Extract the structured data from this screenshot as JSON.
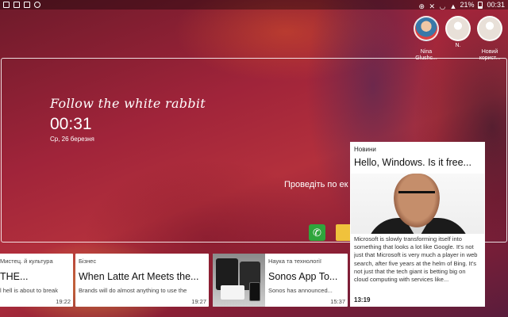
{
  "status_bar": {
    "time": "00:31",
    "battery": "21%"
  },
  "users": [
    {
      "name": "Nina\nGlushc...",
      "avatar": "photo"
    },
    {
      "name": "N.",
      "avatar": "default"
    },
    {
      "name": "Новий\nкорист...",
      "avatar": "default"
    }
  ],
  "lock": {
    "message": "Follow the white rabbit",
    "clock": "00:31",
    "date": "Ср, 26 березня",
    "hint": "Проведіть по ек"
  },
  "cards": [
    {
      "category": "Мистец. й культура",
      "title": "THE...",
      "snippet": "l hell is about to break",
      "time": "19:22"
    },
    {
      "category": "Бізнес",
      "title": "When Latte Art Meets the...",
      "snippet": "Brands will do almost anything to use the",
      "time": "19:27"
    },
    {
      "category": "Наука та технології",
      "title": "Sonos App To...",
      "snippet": "Sonos has announced...",
      "time": "15:37"
    }
  ],
  "featured": {
    "category": "Новини",
    "title": "Hello, Windows. Is it free...",
    "body": "Microsoft is slowly transforming itself into something that looks a lot like Google. It's not just that Microsoft is very much a player in web search, after five years at the helm of Bing. It's not just that the tech giant is betting big on cloud computing with services like...",
    "time": "13:19"
  }
}
